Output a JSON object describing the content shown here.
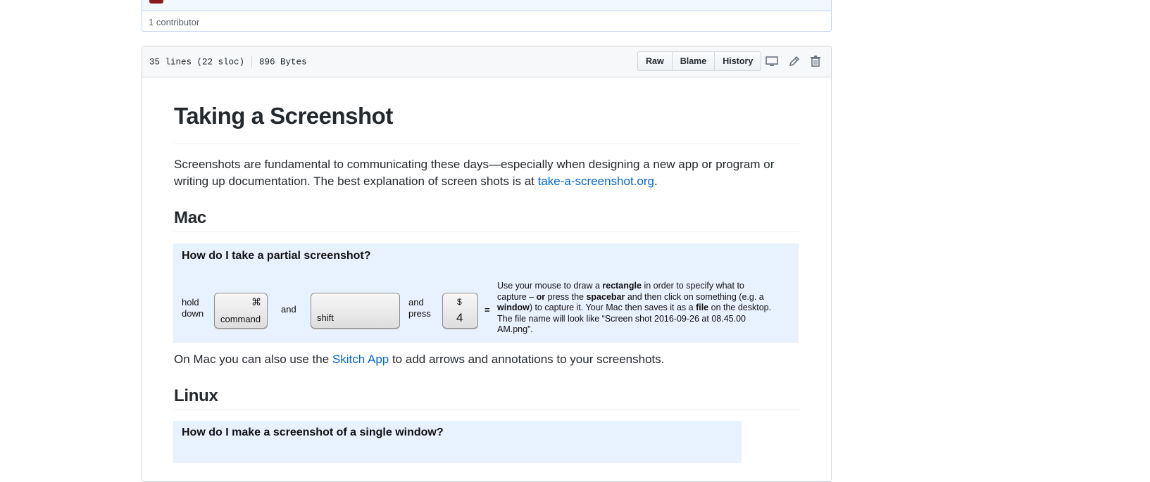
{
  "contributors": {
    "text": "1 contributor"
  },
  "file_header": {
    "lines": "35 lines (22 sloc)",
    "size": "896 Bytes",
    "buttons": {
      "raw": "Raw",
      "blame": "Blame",
      "history": "History"
    },
    "icons": [
      "desktop-icon",
      "pencil-icon",
      "trash-icon"
    ]
  },
  "article": {
    "title": "Taking a Screenshot",
    "intro_prefix": "Screenshots are fundamental to communicating these days—especially when designing a new app or program or writing up documentation. The best explanation of screen shots is at ",
    "intro_link": "take-a-screenshot.org",
    "intro_suffix": ".",
    "mac_heading": "Mac",
    "mac_box": {
      "question": "How do I take a partial screenshot?",
      "hold": "hold",
      "down": "down",
      "key1_symbol": "⌘",
      "key1_label": "command",
      "and1": "and",
      "key2_label": "shift",
      "and2": "and",
      "press": "press",
      "key3_symbol": "$",
      "key3_label": "4",
      "equals": "=",
      "desc": {
        "t1": "Use your mouse to draw a ",
        "b1": "rectangle",
        "t2": " in order to specify what to capture – ",
        "b2": "or",
        "t3": " press the ",
        "b3": "spacebar",
        "t4": " and then click on something (e.g. a ",
        "b4": "window",
        "t5": ") to capture it. Your Mac then saves it as a ",
        "b5": "file",
        "t6": " on the desktop. The file name will look like “Screen shot 2016-09-26 at 08.45.00 AM.png”."
      }
    },
    "mac_note_prefix": "On Mac you can also use the ",
    "mac_note_link": "Skitch App",
    "mac_note_suffix": " to add arrows and annotations to your screenshots.",
    "linux_heading": "Linux",
    "linux_box": {
      "question": "How do I make a screenshot of a single window?"
    }
  },
  "colors": {
    "link": "#0366d6",
    "box_bg": "#e8f1fe",
    "header_bg": "#f6f8fa"
  }
}
